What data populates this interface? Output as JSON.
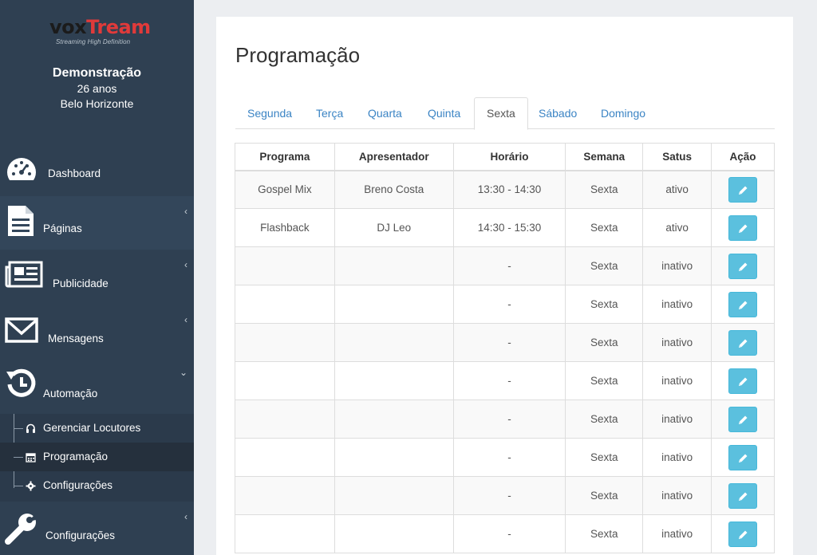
{
  "sidebar": {
    "logo": {
      "brand_a": "vox",
      "brand_b": "Tream",
      "tagline": "Streaming High Definition"
    },
    "profile": {
      "name": "Demonstração",
      "age": "26 anos",
      "city": "Belo Horizonte"
    },
    "nav": [
      {
        "label": "Dashboard",
        "icon": "dashboard-icon"
      },
      {
        "label": "Páginas",
        "icon": "file-icon"
      },
      {
        "label": "Publicidade",
        "icon": "newspaper-icon"
      },
      {
        "label": "Mensagens",
        "icon": "envelope-icon"
      },
      {
        "label": "Automação",
        "icon": "history-icon"
      },
      {
        "label": "Configurações",
        "icon": "wrench-icon"
      }
    ],
    "submenu": [
      {
        "label": "Gerenciar Locutores",
        "icon": "headphones-icon"
      },
      {
        "label": "Programação",
        "icon": "calendar-icon"
      },
      {
        "label": "Configurações",
        "icon": "gear-icon"
      }
    ],
    "chevron_left": "‹",
    "chevron_down": "⌄"
  },
  "main": {
    "title": "Programação",
    "tabs": [
      "Segunda",
      "Terça",
      "Quarta",
      "Quinta",
      "Sexta",
      "Sábado",
      "Domingo"
    ],
    "active_tab": "Sexta",
    "table": {
      "headers": [
        "Programa",
        "Apresentador",
        "Horário",
        "Semana",
        "Satus",
        "Ação"
      ],
      "rows": [
        [
          "Gospel Mix",
          "Breno Costa",
          "13:30 - 14:30",
          "Sexta",
          "ativo"
        ],
        [
          "Flashback",
          "DJ Leo",
          "14:30 - 15:30",
          "Sexta",
          "ativo"
        ],
        [
          "",
          "",
          "-",
          "Sexta",
          "inativo"
        ],
        [
          "",
          "",
          "-",
          "Sexta",
          "inativo"
        ],
        [
          "",
          "",
          "-",
          "Sexta",
          "inativo"
        ],
        [
          "",
          "",
          "-",
          "Sexta",
          "inativo"
        ],
        [
          "",
          "",
          "-",
          "Sexta",
          "inativo"
        ],
        [
          "",
          "",
          "-",
          "Sexta",
          "inativo"
        ],
        [
          "",
          "",
          "-",
          "Sexta",
          "inativo"
        ],
        [
          "",
          "",
          "-",
          "Sexta",
          "inativo"
        ]
      ],
      "action_icon": "pencil-icon"
    }
  },
  "colors": {
    "sidebar": "#2f4052",
    "accent_button": "#5bc0de",
    "tab_link": "#3b84c4",
    "logo_red": "#e03a3a"
  }
}
